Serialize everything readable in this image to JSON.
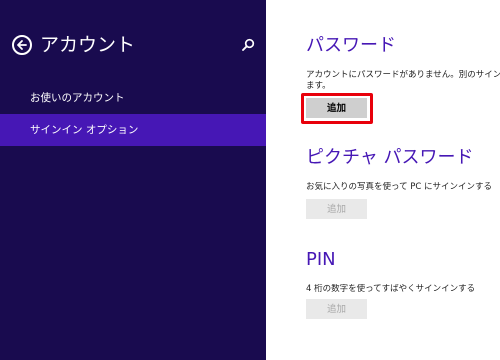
{
  "sidebar": {
    "title": "アカウント",
    "items": [
      {
        "label": "お使いのアカウント"
      },
      {
        "label": "サインイン オプション"
      }
    ]
  },
  "password": {
    "heading": "パスワード",
    "description_line1": "アカウントにパスワードがありません。別のサインイン オ",
    "description_line2": "ます。",
    "add_label": "追加"
  },
  "picture_password": {
    "heading": "ピクチャ パスワード",
    "description": "お気に入りの写真を使って PC にサインインする",
    "add_label": "追加"
  },
  "pin": {
    "heading": "PIN",
    "description": "4 桁の数字を使ってすばやくサインインする",
    "add_label": "追加"
  },
  "colors": {
    "sidebar_bg": "#190b4f",
    "selected_bg": "#4617b5",
    "heading_color": "#4617b5",
    "highlight_border": "#e8000b"
  }
}
